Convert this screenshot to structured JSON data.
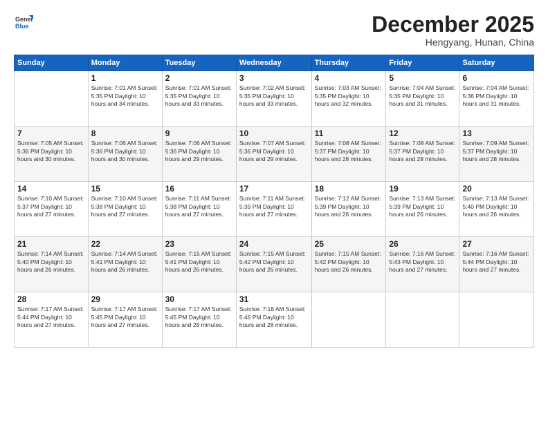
{
  "header": {
    "logo_line1": "General",
    "logo_line2": "Blue",
    "month": "December 2025",
    "location": "Hengyang, Hunan, China"
  },
  "weekdays": [
    "Sunday",
    "Monday",
    "Tuesday",
    "Wednesday",
    "Thursday",
    "Friday",
    "Saturday"
  ],
  "weeks": [
    [
      {
        "day": "",
        "info": ""
      },
      {
        "day": "1",
        "info": "Sunrise: 7:01 AM\nSunset: 5:35 PM\nDaylight: 10 hours\nand 34 minutes."
      },
      {
        "day": "2",
        "info": "Sunrise: 7:01 AM\nSunset: 5:35 PM\nDaylight: 10 hours\nand 33 minutes."
      },
      {
        "day": "3",
        "info": "Sunrise: 7:02 AM\nSunset: 5:35 PM\nDaylight: 10 hours\nand 33 minutes."
      },
      {
        "day": "4",
        "info": "Sunrise: 7:03 AM\nSunset: 5:35 PM\nDaylight: 10 hours\nand 32 minutes."
      },
      {
        "day": "5",
        "info": "Sunrise: 7:04 AM\nSunset: 5:35 PM\nDaylight: 10 hours\nand 31 minutes."
      },
      {
        "day": "6",
        "info": "Sunrise: 7:04 AM\nSunset: 5:36 PM\nDaylight: 10 hours\nand 31 minutes."
      }
    ],
    [
      {
        "day": "7",
        "info": "Sunrise: 7:05 AM\nSunset: 5:36 PM\nDaylight: 10 hours\nand 30 minutes."
      },
      {
        "day": "8",
        "info": "Sunrise: 7:06 AM\nSunset: 5:36 PM\nDaylight: 10 hours\nand 30 minutes."
      },
      {
        "day": "9",
        "info": "Sunrise: 7:06 AM\nSunset: 5:36 PM\nDaylight: 10 hours\nand 29 minutes."
      },
      {
        "day": "10",
        "info": "Sunrise: 7:07 AM\nSunset: 5:36 PM\nDaylight: 10 hours\nand 29 minutes."
      },
      {
        "day": "11",
        "info": "Sunrise: 7:08 AM\nSunset: 5:37 PM\nDaylight: 10 hours\nand 28 minutes."
      },
      {
        "day": "12",
        "info": "Sunrise: 7:08 AM\nSunset: 5:37 PM\nDaylight: 10 hours\nand 28 minutes."
      },
      {
        "day": "13",
        "info": "Sunrise: 7:09 AM\nSunset: 5:37 PM\nDaylight: 10 hours\nand 28 minutes."
      }
    ],
    [
      {
        "day": "14",
        "info": "Sunrise: 7:10 AM\nSunset: 5:37 PM\nDaylight: 10 hours\nand 27 minutes."
      },
      {
        "day": "15",
        "info": "Sunrise: 7:10 AM\nSunset: 5:38 PM\nDaylight: 10 hours\nand 27 minutes."
      },
      {
        "day": "16",
        "info": "Sunrise: 7:11 AM\nSunset: 5:38 PM\nDaylight: 10 hours\nand 27 minutes."
      },
      {
        "day": "17",
        "info": "Sunrise: 7:11 AM\nSunset: 5:39 PM\nDaylight: 10 hours\nand 27 minutes."
      },
      {
        "day": "18",
        "info": "Sunrise: 7:12 AM\nSunset: 5:39 PM\nDaylight: 10 hours\nand 26 minutes."
      },
      {
        "day": "19",
        "info": "Sunrise: 7:13 AM\nSunset: 5:39 PM\nDaylight: 10 hours\nand 26 minutes."
      },
      {
        "day": "20",
        "info": "Sunrise: 7:13 AM\nSunset: 5:40 PM\nDaylight: 10 hours\nand 26 minutes."
      }
    ],
    [
      {
        "day": "21",
        "info": "Sunrise: 7:14 AM\nSunset: 5:40 PM\nDaylight: 10 hours\nand 26 minutes."
      },
      {
        "day": "22",
        "info": "Sunrise: 7:14 AM\nSunset: 5:41 PM\nDaylight: 10 hours\nand 26 minutes."
      },
      {
        "day": "23",
        "info": "Sunrise: 7:15 AM\nSunset: 5:41 PM\nDaylight: 10 hours\nand 26 minutes."
      },
      {
        "day": "24",
        "info": "Sunrise: 7:15 AM\nSunset: 5:42 PM\nDaylight: 10 hours\nand 26 minutes."
      },
      {
        "day": "25",
        "info": "Sunrise: 7:15 AM\nSunset: 5:42 PM\nDaylight: 10 hours\nand 26 minutes."
      },
      {
        "day": "26",
        "info": "Sunrise: 7:16 AM\nSunset: 5:43 PM\nDaylight: 10 hours\nand 27 minutes."
      },
      {
        "day": "27",
        "info": "Sunrise: 7:16 AM\nSunset: 5:44 PM\nDaylight: 10 hours\nand 27 minutes."
      }
    ],
    [
      {
        "day": "28",
        "info": "Sunrise: 7:17 AM\nSunset: 5:44 PM\nDaylight: 10 hours\nand 27 minutes."
      },
      {
        "day": "29",
        "info": "Sunrise: 7:17 AM\nSunset: 5:45 PM\nDaylight: 10 hours\nand 27 minutes."
      },
      {
        "day": "30",
        "info": "Sunrise: 7:17 AM\nSunset: 5:45 PM\nDaylight: 10 hours\nand 28 minutes."
      },
      {
        "day": "31",
        "info": "Sunrise: 7:18 AM\nSunset: 5:46 PM\nDaylight: 10 hours\nand 28 minutes."
      },
      {
        "day": "",
        "info": ""
      },
      {
        "day": "",
        "info": ""
      },
      {
        "day": "",
        "info": ""
      }
    ]
  ]
}
